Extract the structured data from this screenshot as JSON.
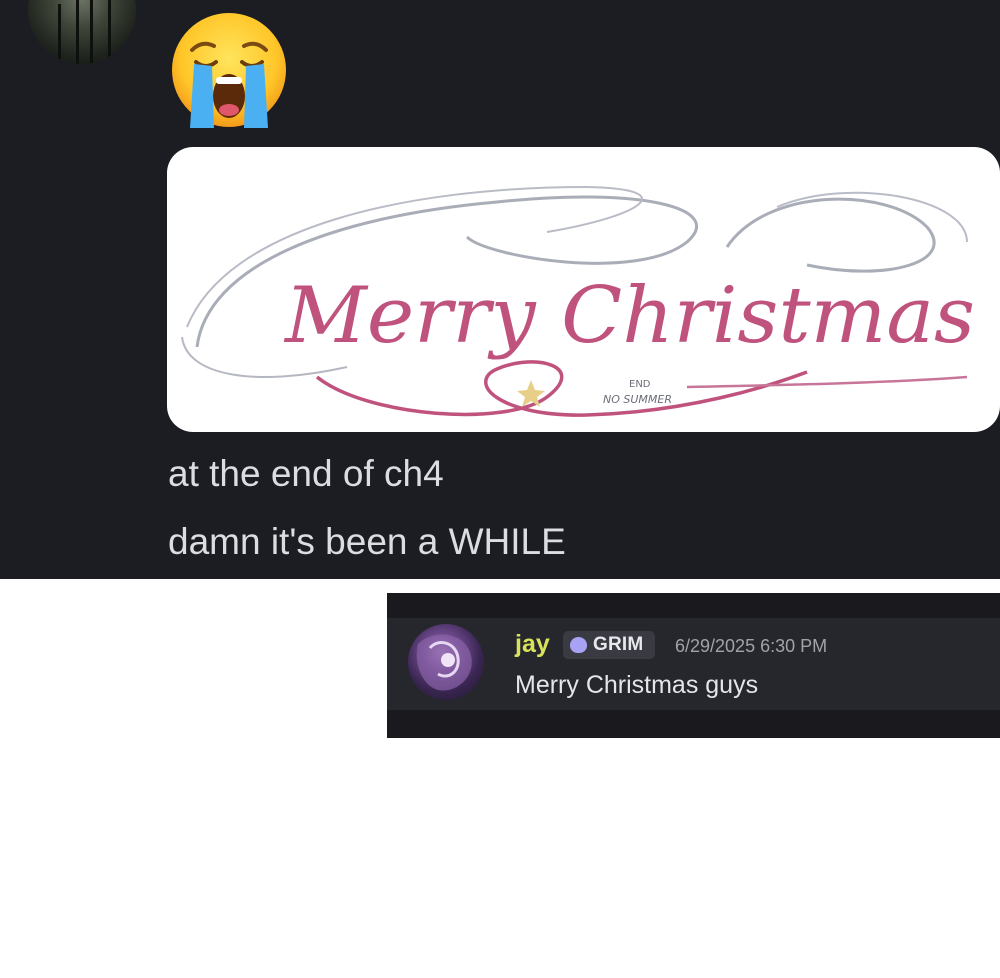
{
  "message": {
    "emoji": "loudly-crying-face",
    "lines": [
      "at the end of ch4",
      "damn it's been a WHILE"
    ],
    "image": {
      "title": "Merry Christmas",
      "signature_line1": "END",
      "signature_line2": "NO SUMMER"
    }
  },
  "quoted": {
    "username": "jay",
    "tag": "GRIM",
    "timestamp": "6/29/2025 6:30 PM",
    "text": "Merry Christmas guys"
  },
  "colors": {
    "chat_bg": "#1c1d22",
    "text": "#dcdde1",
    "username": "#d9e35a",
    "tag_icon": "#a7a2f3",
    "script_pink": "#c0527e",
    "script_grey": "#a9adb8"
  }
}
